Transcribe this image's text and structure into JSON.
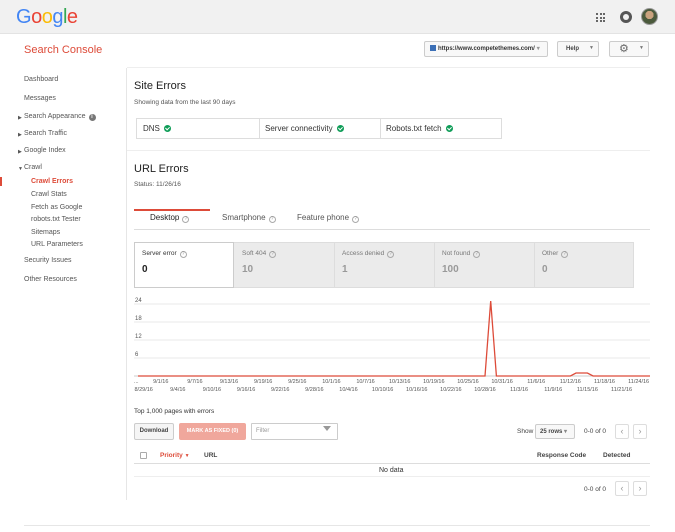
{
  "header": {
    "logo_letters": [
      "G",
      "o",
      "o",
      "g",
      "l",
      "e"
    ],
    "apps_icon": "apps-grid-icon",
    "notifications_icon": "notifications-icon",
    "avatar_icon": "user-avatar"
  },
  "console": {
    "title": "Search Console",
    "site": "https://www.competethemes.com/",
    "help_label": "Help",
    "settings_icon": "gear-icon"
  },
  "sidebar": {
    "dashboard": "Dashboard",
    "messages": "Messages",
    "search_appearance": "Search Appearance",
    "search_traffic": "Search Traffic",
    "google_index": "Google Index",
    "crawl": "Crawl",
    "crawl_sub": [
      "Crawl Errors",
      "Crawl Stats",
      "Fetch as Google",
      "robots.txt Tester",
      "Sitemaps",
      "URL Parameters"
    ],
    "security_issues": "Security Issues",
    "other_resources": "Other Resources",
    "active_item": "Crawl Errors",
    "accent_color": "#dd4b39"
  },
  "site_errors": {
    "title": "Site Errors",
    "subtitle": "Showing data from the last 90 days",
    "checks": [
      {
        "label": "DNS",
        "status": "ok"
      },
      {
        "label": "Server connectivity",
        "status": "ok"
      },
      {
        "label": "Robots.txt fetch",
        "status": "ok"
      }
    ]
  },
  "url_errors": {
    "title": "URL Errors",
    "status": "Status: 11/26/16",
    "tabs": [
      "Desktop",
      "Smartphone",
      "Feature phone"
    ],
    "active_tab": "Desktop",
    "cards": [
      {
        "label": "Server error",
        "value": "0"
      },
      {
        "label": "Soft 404",
        "value": "10"
      },
      {
        "label": "Access denied",
        "value": "1"
      },
      {
        "label": "Not found",
        "value": "100"
      },
      {
        "label": "Other",
        "value": "0"
      }
    ]
  },
  "chart_data": {
    "type": "line",
    "title": "",
    "xlabel": "",
    "ylabel": "",
    "ylim": [
      0,
      26
    ],
    "y_ticks": [
      6,
      12,
      18,
      24
    ],
    "x_ticks_top": [
      "9/1/16",
      "9/7/16",
      "9/13/16",
      "9/19/16",
      "9/25/16",
      "10/1/16",
      "10/7/16",
      "10/13/16",
      "10/19/16",
      "10/25/16",
      "10/31/16",
      "11/6/16",
      "11/12/16",
      "11/18/16",
      "11/24/16"
    ],
    "x_ticks_bottom": [
      "8/29/16",
      "9/4/16",
      "9/10/16",
      "9/16/16",
      "9/22/16",
      "9/28/16",
      "10/4/16",
      "10/10/16",
      "10/16/16",
      "10/22/16",
      "10/28/16",
      "11/3/16",
      "11/9/16",
      "11/15/16",
      "11/21/16"
    ],
    "x_start_label": "...",
    "series": [
      {
        "color": "#dd4b39",
        "points": [
          {
            "x": "8/28/16",
            "y": 0
          },
          {
            "x": "10/28/16",
            "y": 0
          },
          {
            "x": "10/29/16",
            "y": 25
          },
          {
            "x": "10/30/16",
            "y": 0
          },
          {
            "x": "11/12/16",
            "y": 0
          },
          {
            "x": "11/13/16",
            "y": 1
          },
          {
            "x": "11/15/16",
            "y": 1
          },
          {
            "x": "11/16/16",
            "y": 0
          },
          {
            "x": "11/26/16",
            "y": 0
          }
        ]
      }
    ],
    "grid": true
  },
  "table": {
    "caption": "Top 1,000 pages with errors",
    "download_label": "Download",
    "mark_fixed_label": "MARK AS FIXED (0)",
    "filter_placeholder": "Filter",
    "show_label": "Show",
    "rows_value": "25 rows",
    "pagination": "0-0 of 0",
    "prev_icon": "chevron-left-icon",
    "next_icon": "chevron-right-icon",
    "columns": [
      "Priority",
      "URL",
      "Response Code",
      "Detected"
    ],
    "empty_text": "No data"
  }
}
